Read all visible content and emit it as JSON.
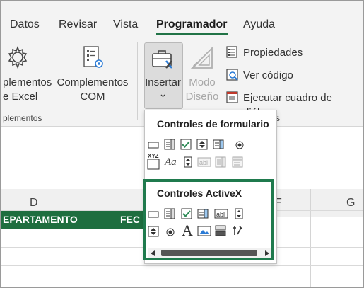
{
  "ribbon_tabs": [
    "Datos",
    "Revisar",
    "Vista",
    "Programador",
    "Ayuda"
  ],
  "active_tab": "Programador",
  "addins": {
    "excel_addins_line1": "plementos",
    "excel_addins_line2": "e Excel",
    "com_addins_line1": "Complementos",
    "com_addins_line2": "COM",
    "group_label": "plementos"
  },
  "controls_group": {
    "insert_label": "Insertar",
    "insert_chevron": "⌄",
    "design_mode_line1": "Modo",
    "design_mode_line2": "Diseño",
    "properties": "Propiedades",
    "view_code": "Ver código",
    "run_dialog": "Ejecutar cuadro de diálog",
    "group_label_tail": "s"
  },
  "sheet": {
    "columns": [
      "D",
      "F",
      "G"
    ],
    "green_row": [
      "EPARTAMENTO",
      "FEC"
    ]
  },
  "insert_menu": {
    "form_controls_title": "Controles de formulario",
    "activex_title": "Controles ActiveX",
    "font_glyph": "Aa",
    "label_glyph": "A",
    "xyz_glyph": "XYZ",
    "abl_glyph": "abl"
  },
  "colors": {
    "accent": "#217346",
    "green_row": "#1e6e3f",
    "highlight_border": "#1f7a4d"
  }
}
